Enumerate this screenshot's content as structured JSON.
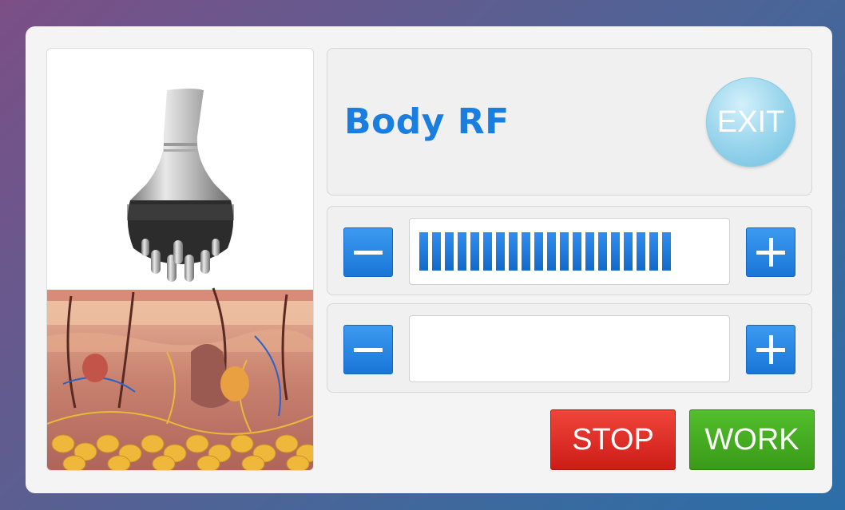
{
  "header": {
    "title": "Body RF",
    "exit_label": "EXIT"
  },
  "level1": {
    "level": 20,
    "max": 20
  },
  "level2": {
    "level": 0,
    "max": 20
  },
  "actions": {
    "stop_label": "STOP",
    "work_label": "WORK"
  },
  "colors": {
    "accent": "#1a7ee0",
    "stop": "#e0302a",
    "work": "#46ae22",
    "segment": "#1f7ee0"
  }
}
